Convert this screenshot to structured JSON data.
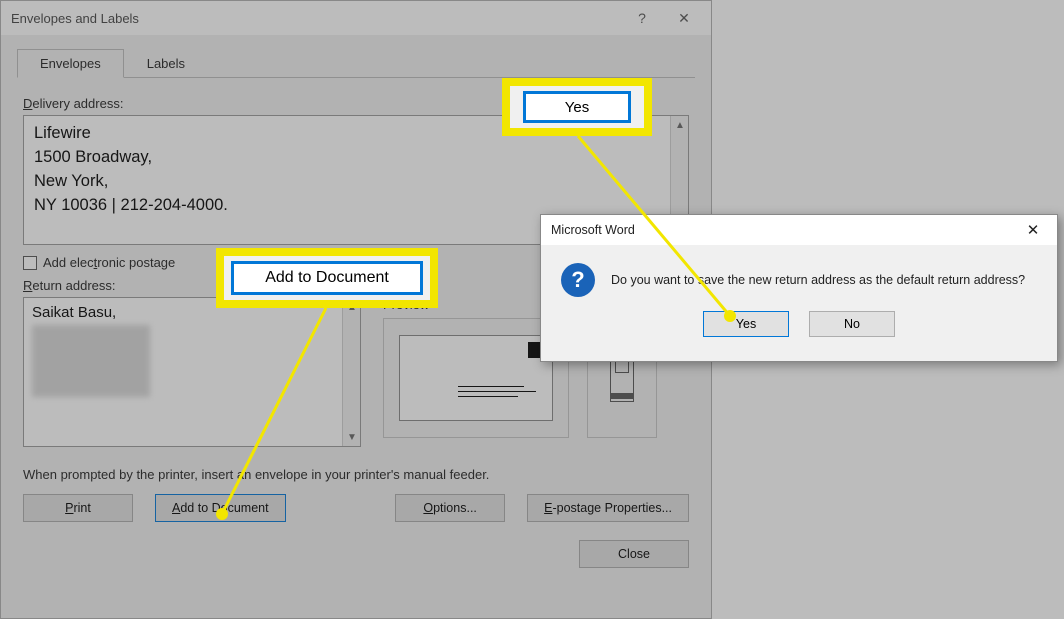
{
  "dialog": {
    "title": "Envelopes and Labels",
    "tabs": {
      "envelopes": "Envelopes",
      "labels": "Labels"
    },
    "delivery_label": "Delivery address:",
    "delivery_address": {
      "line1": "Lifewire",
      "line2": "1500 Broadway,",
      "line3": "New York,",
      "line4": "NY 10036 | 212-204-4000."
    },
    "electronic_postage_label": "Add electronic postage",
    "return_label": "Return address:",
    "return_address": {
      "line1": "Saikat Basu,"
    },
    "preview_label": "Preview",
    "hint": "When prompted by the printer, insert an envelope in your printer's manual feeder.",
    "buttons": {
      "print": "Print",
      "add_to_document": "Add to Document",
      "options": "Options...",
      "epostage": "E-postage Properties...",
      "close": "Close"
    }
  },
  "callouts": {
    "yes_label": "Yes",
    "add_label": "Add to Document"
  },
  "prompt": {
    "title": "Microsoft Word",
    "message": "Do you want to save the new return address as the default return address?",
    "yes": "Yes",
    "no": "No"
  }
}
